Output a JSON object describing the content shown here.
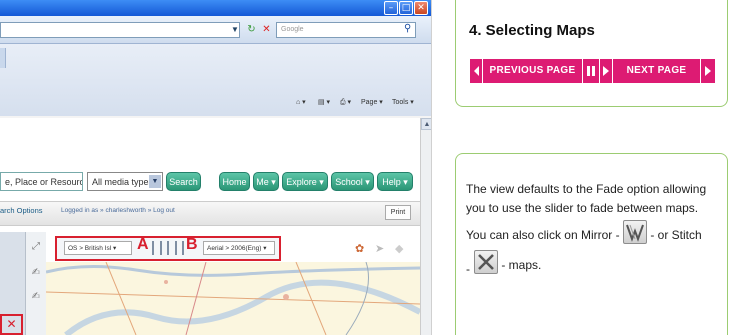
{
  "browser": {
    "search_placeholder": "Google",
    "cmd_items": [
      "Page",
      "Tools"
    ]
  },
  "site": {
    "search_value": "e, Place or Resource",
    "media_select": "All media types",
    "search_button": "Search",
    "nav_buttons": [
      "Home",
      "Me ▾",
      "Explore ▾",
      "School ▾",
      "Help ▾"
    ],
    "search_options": "arch Options",
    "logged_in": "Logged in as » charleshworth » Log out",
    "print": "Print",
    "map_toolbar": {
      "os_select": "OS > British Isl",
      "label_a": "A",
      "label_b": "B",
      "aerial_select": "Aerial > 2006(Eng)"
    }
  },
  "guide": {
    "heading": "4. Selecting Maps",
    "prev_label": "PREVIOUS PAGE",
    "next_label": "NEXT PAGE",
    "para1": "The view defaults to the Fade option allowing you to use the slider to fade between maps.",
    "para2_a": "You can also click on Mirror -",
    "para2_b": "- or Stitch",
    "para2_c": "- maps."
  },
  "colors": {
    "accent_pink": "#dd1b73",
    "box_border": "#9ccc72",
    "highlight_red": "#d8202f",
    "site_green": "#2b9676"
  }
}
